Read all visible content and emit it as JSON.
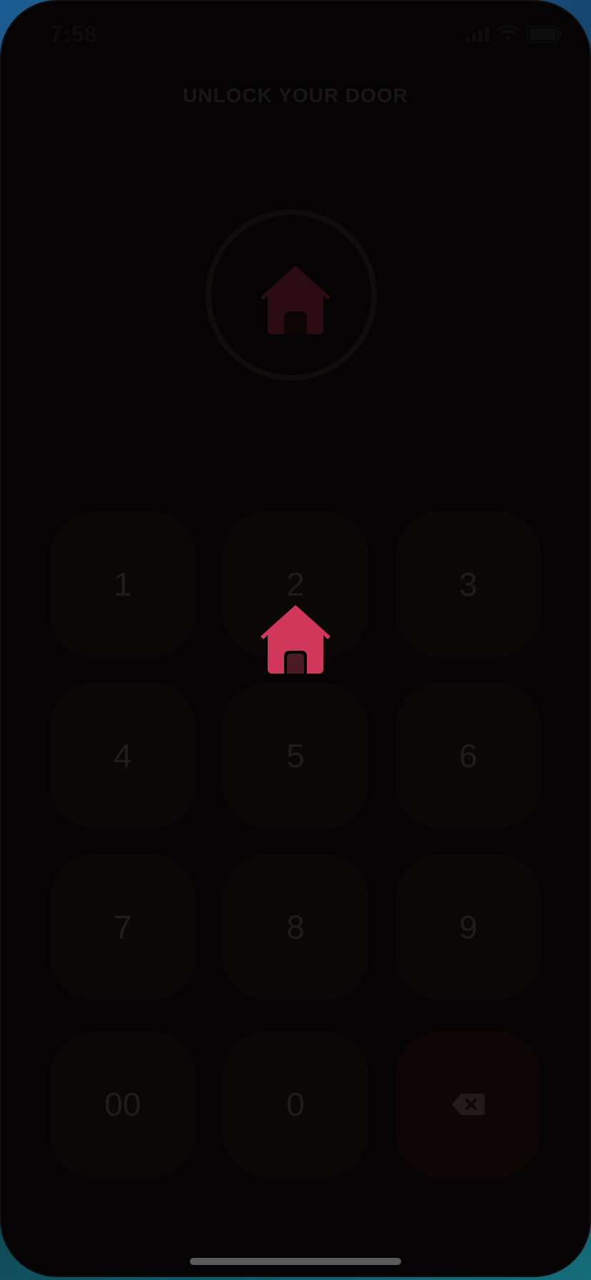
{
  "status_bar": {
    "time": "7:58",
    "icons": [
      "signal-icon",
      "wifi-icon",
      "battery-icon"
    ]
  },
  "header": {
    "title": "UNLOCK YOUR DOOR"
  },
  "lock_indicator": {
    "icon": "home-icon"
  },
  "keypad": {
    "keys": [
      {
        "label": "1"
      },
      {
        "label": "2"
      },
      {
        "label": "3"
      },
      {
        "label": "4"
      },
      {
        "label": "5"
      },
      {
        "label": "6"
      },
      {
        "label": "7"
      },
      {
        "label": "8"
      },
      {
        "label": "9"
      },
      {
        "label": "00"
      },
      {
        "label": "0"
      },
      {
        "label": "",
        "icon": "backspace-icon"
      }
    ]
  },
  "floating_icon": {
    "icon": "home-icon"
  },
  "colors": {
    "accent": "#d1375b",
    "door": "#4a1c22",
    "background": "#050303",
    "key_background": "#0a0807",
    "key_text": "#1f1d1c"
  }
}
